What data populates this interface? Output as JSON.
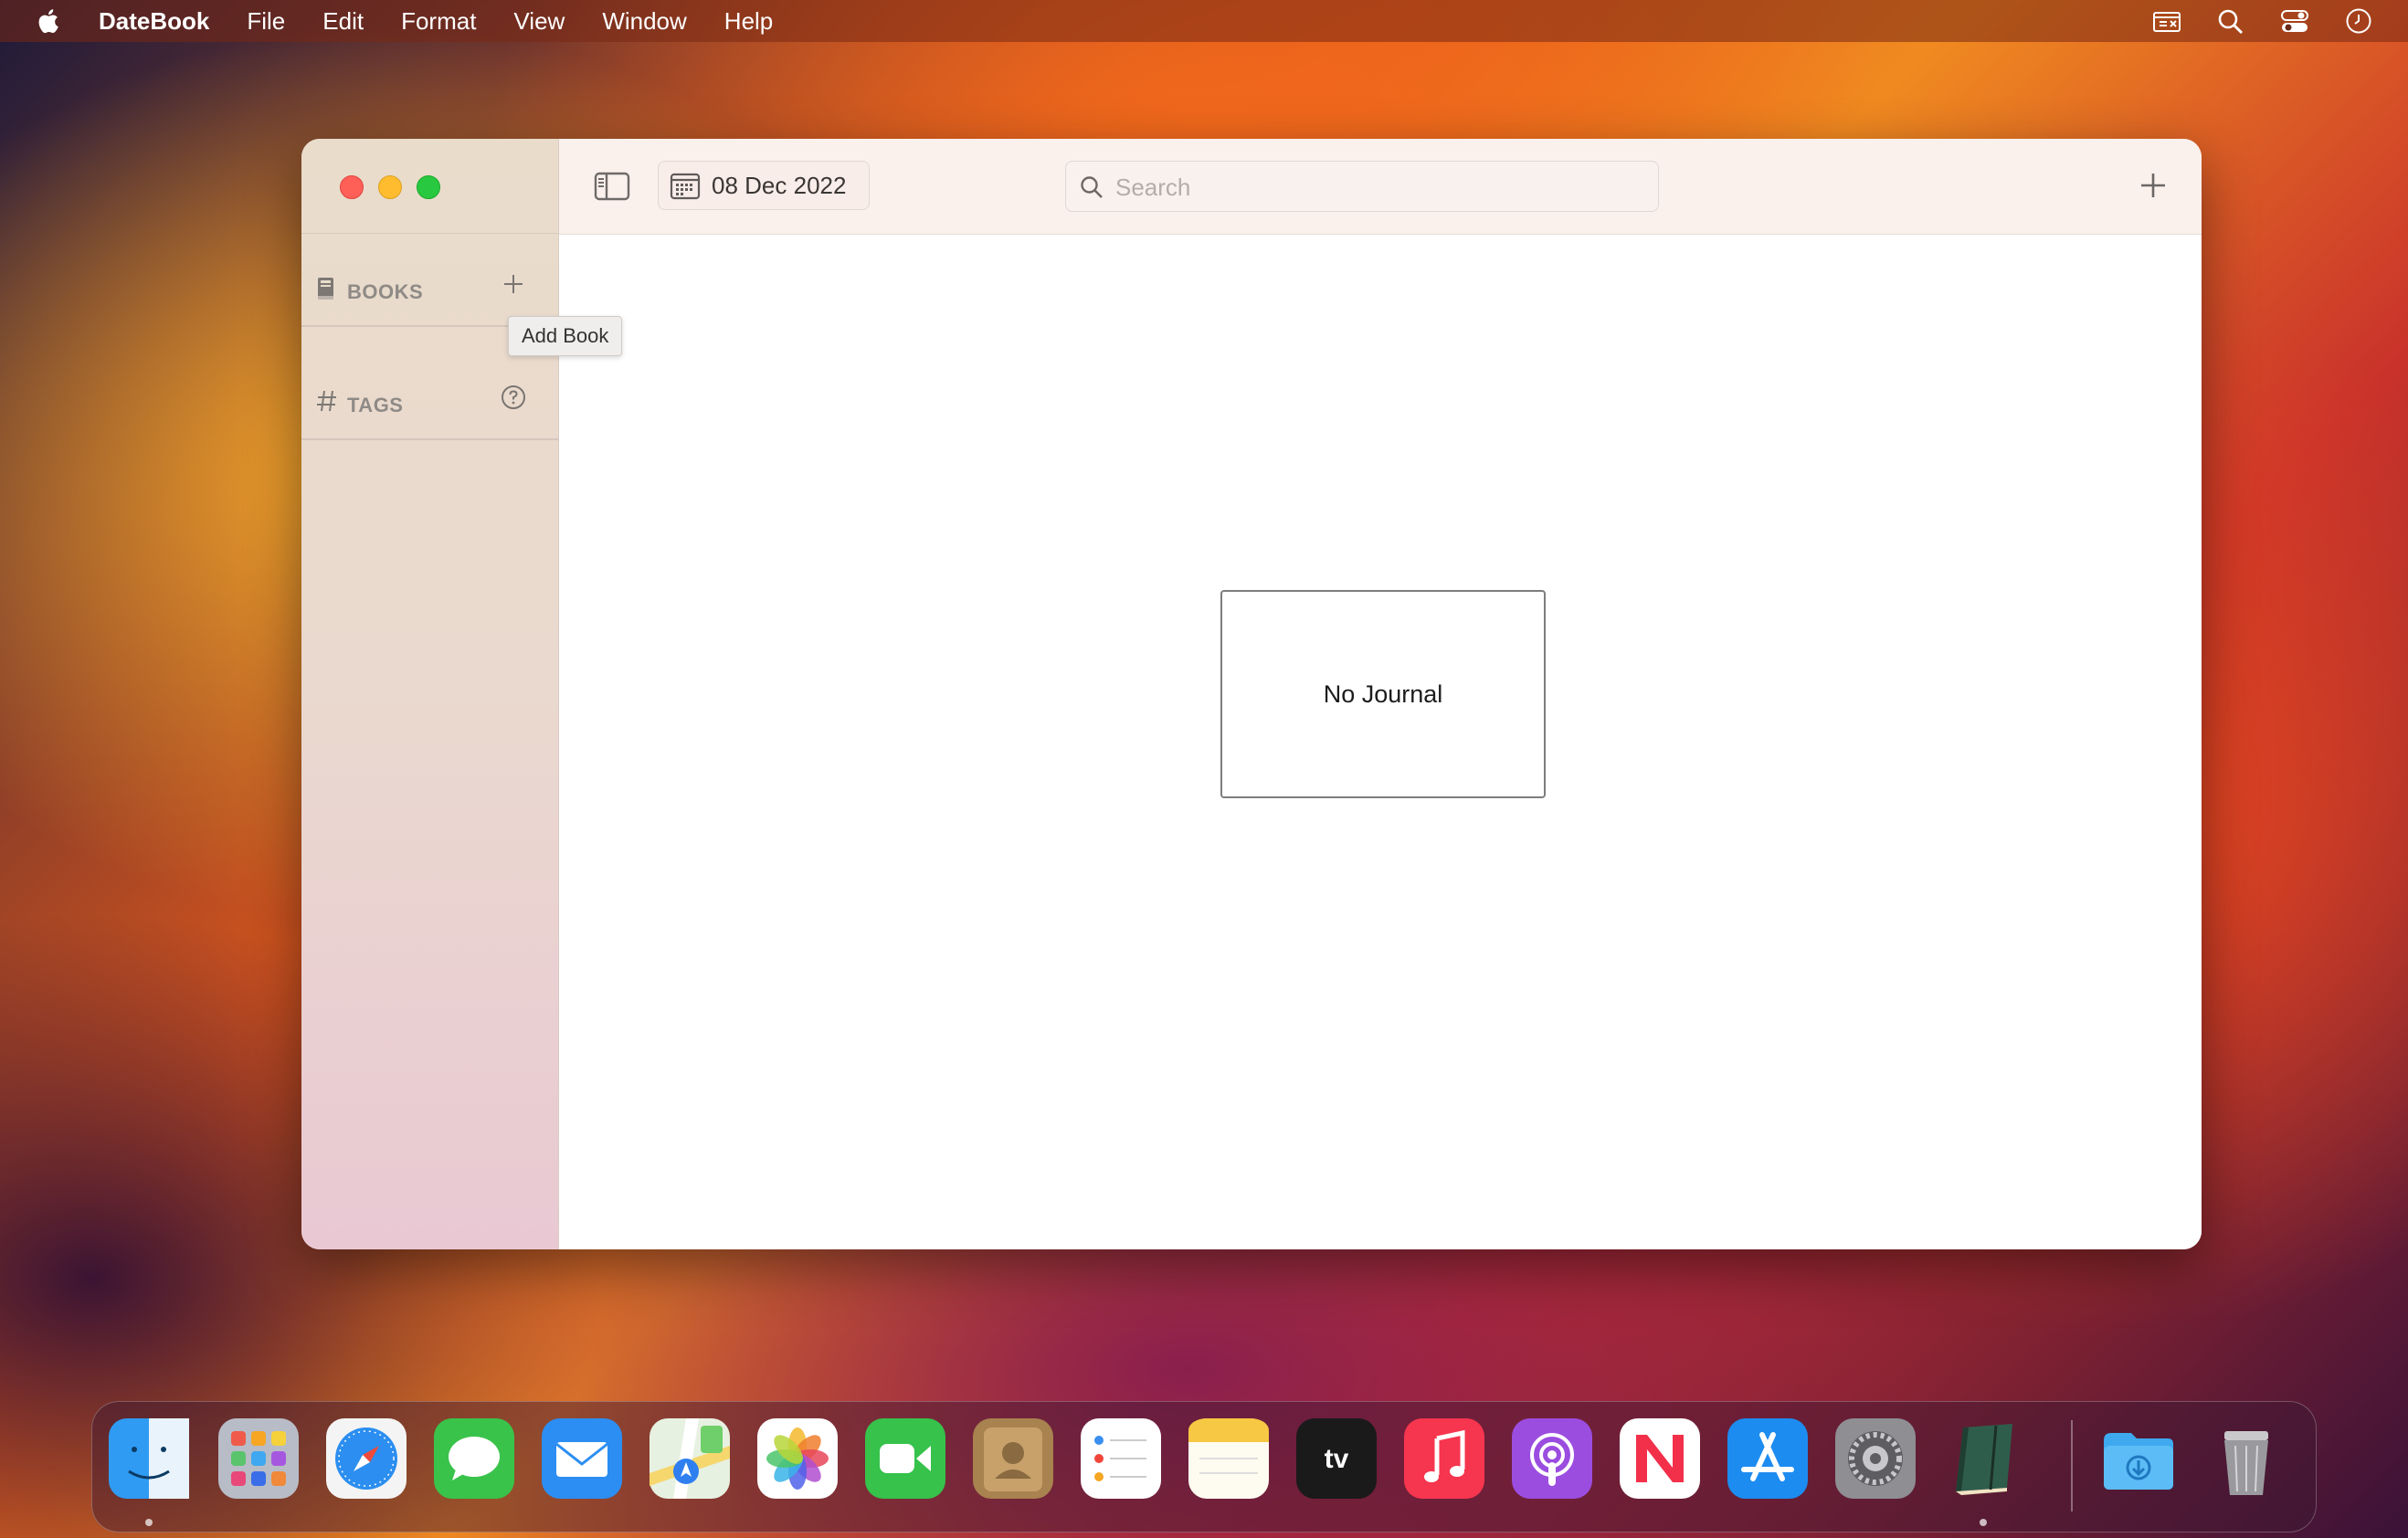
{
  "menubar": {
    "app_name": "DateBook",
    "items": [
      "File",
      "Edit",
      "Format",
      "View",
      "Window",
      "Help"
    ],
    "right_icons": [
      "screen-share-icon",
      "search-icon",
      "control-center-icon",
      "clock-icon"
    ]
  },
  "window": {
    "toolbar": {
      "date": "08 Dec 2022",
      "search_placeholder": "Search",
      "search_value": ""
    },
    "sidebar": {
      "books_label": "BOOKS",
      "tags_label": "TAGS",
      "tooltip": "Add Book"
    },
    "content": {
      "empty_message": "No Journal"
    }
  },
  "dock": {
    "apps": [
      "Finder",
      "Launchpad",
      "Safari",
      "Messages",
      "Mail",
      "Maps",
      "Photos",
      "FaceTime",
      "Contacts",
      "Reminders",
      "Notes",
      "TV",
      "Music",
      "Podcasts",
      "News",
      "App Store",
      "System Settings",
      "DateBook",
      "Downloads",
      "Trash"
    ]
  },
  "colors": {
    "traffic_red": "#fe5f57",
    "traffic_yellow": "#febc2e",
    "traffic_green": "#28c840",
    "sidebar_bg": "#e9dccb",
    "toolbar_bg": "#faf0ec"
  }
}
